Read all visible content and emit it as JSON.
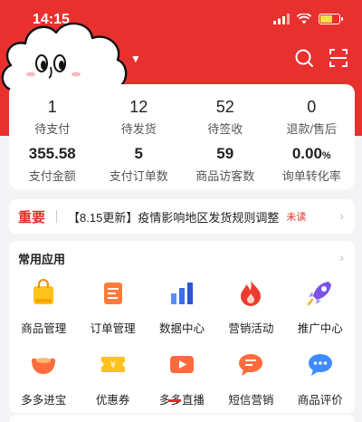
{
  "status_bar": {
    "time": "14:15"
  },
  "stats": {
    "row1": [
      {
        "value": "1",
        "label": "待支付"
      },
      {
        "value": "12",
        "label": "待发货"
      },
      {
        "value": "52",
        "label": "待签收"
      },
      {
        "value": "0",
        "label": "退款/售后"
      }
    ],
    "row2": [
      {
        "value": "355.58",
        "label": "支付金额"
      },
      {
        "value": "5",
        "label": "支付订单数"
      },
      {
        "value": "59",
        "label": "商品访客数"
      },
      {
        "value": "0.00",
        "unit": "%",
        "label": "询单转化率"
      }
    ]
  },
  "notice": {
    "tag": "重要",
    "text": "【8.15更新】疫情影响地区发货规则调整",
    "badge": "未读"
  },
  "apps": {
    "title": "常用应用",
    "items": [
      {
        "label": "商品管理",
        "icon": "shopping-bag-icon"
      },
      {
        "label": "订单管理",
        "icon": "order-list-icon"
      },
      {
        "label": "数据中心",
        "icon": "bar-chart-icon"
      },
      {
        "label": "营销活动",
        "icon": "flame-icon"
      },
      {
        "label": "推广中心",
        "icon": "rocket-icon"
      },
      {
        "label": "多多进宝",
        "icon": "treasure-icon"
      },
      {
        "label": "优惠券",
        "icon": "coupon-icon"
      },
      {
        "label": "多多直播",
        "icon": "live-video-icon"
      },
      {
        "label": "短信营销",
        "icon": "sms-icon"
      },
      {
        "label": "商品评价",
        "icon": "review-icon"
      }
    ]
  },
  "colors": {
    "brand": "#e8312f",
    "accent_red": "#e02e24"
  }
}
